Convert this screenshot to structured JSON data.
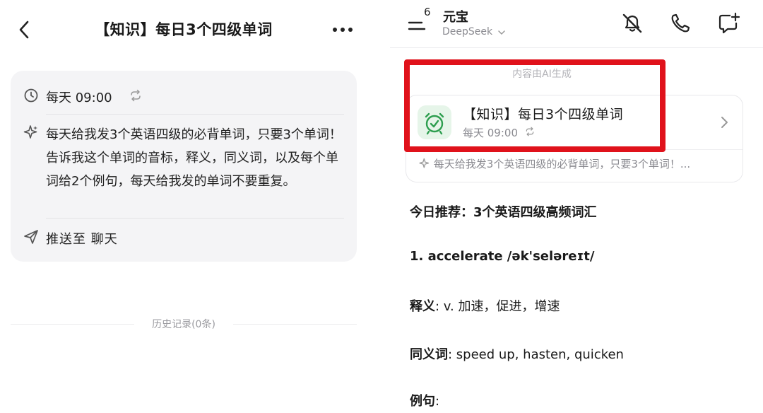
{
  "left": {
    "title": "【知识】每日3个四级单词",
    "schedule": "每天 09:00",
    "prompt": "每天给我发3个英语四级的必背单词，只要3个单词！告诉我这个单词的音标，释义，同义词，以及每个单词给2个例句，每天给我发的单词不要重复。",
    "push_target": "推送至 聊天",
    "history": "历史记录(0条)"
  },
  "right": {
    "header": {
      "badge": "6",
      "assistant_name": "元宝",
      "model": "DeepSeek"
    },
    "ai_notice": "内容由AI生成",
    "task": {
      "title": "【知识】每日3个四级单词",
      "time": "每天 09:00",
      "prompt_preview": "每天给我发3个英语四级的必背单词，只要3个单词！..."
    },
    "content": {
      "heading": "今日推荐：3个英语四级高频词汇",
      "word": "1. accelerate /ək'seləreɪt/",
      "def_label": "释义",
      "def": ": v. 加速，促进，增速",
      "syn_label": "同义词",
      "syn": ": speed up, hasten, quicken",
      "ex_label": "例句",
      "ex": ":"
    }
  },
  "colors": {
    "highlight": "#e0121b",
    "clock_bg": "#e6f5e9",
    "clock_green": "#2e9e4f"
  },
  "icons": [
    "back-icon",
    "more-icon",
    "clock-icon",
    "repeat-icon",
    "sparkle-icon",
    "send-icon",
    "menu-icon",
    "chevron-down-icon",
    "mute-icon",
    "phone-icon",
    "new-chat-icon",
    "alarm-icon",
    "chevron-right-icon"
  ]
}
